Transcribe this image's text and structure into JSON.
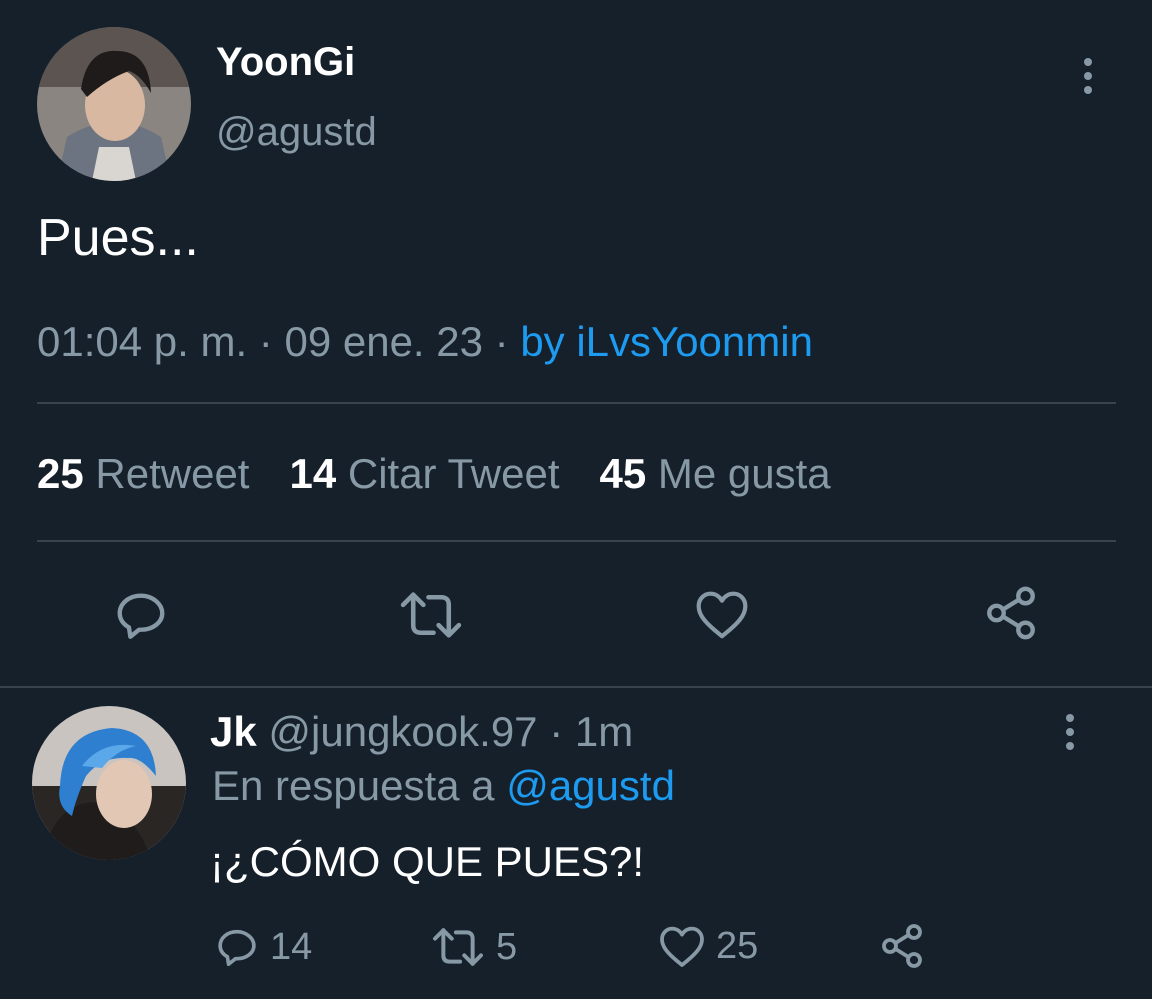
{
  "tweet": {
    "author_name": "YoonGi",
    "author_handle": "@agustd",
    "text": "Pues...",
    "time": "01:04 p. m.",
    "sep1": "·",
    "date": "09 ene. 23",
    "sep2": "·",
    "source": "by iLvsYoonmin",
    "stats": [
      {
        "count": "25",
        "label": "Retweet"
      },
      {
        "count": "14",
        "label": "Citar Tweet"
      },
      {
        "count": "45",
        "label": "Me gusta"
      }
    ],
    "actions": [
      "reply-icon",
      "retweet-icon",
      "like-icon",
      "share-icon"
    ]
  },
  "reply": {
    "author_name": "Jk",
    "author_handle": "@jungkook.97",
    "sep": "·",
    "age": "1m",
    "in_reply_prefix": "En respuesta a",
    "in_reply_handle": "@agustd",
    "text": "¡¿CÓMO QUE PUES?!",
    "reply_count": "14",
    "retweet_count": "5",
    "like_count": "25"
  },
  "colors": {
    "background": "#15202b",
    "muted": "#8899a6",
    "link": "#1d9bf0",
    "divider": "#38444d"
  }
}
